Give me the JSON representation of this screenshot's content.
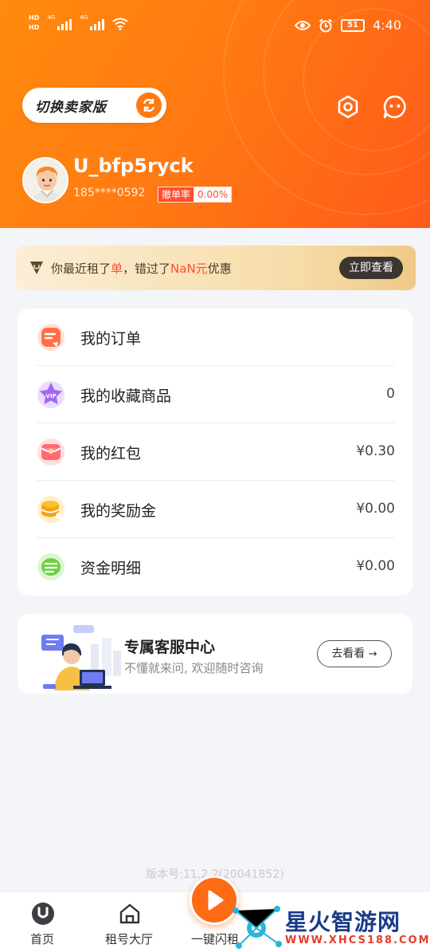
{
  "status_bar": {
    "hd_label": "HD",
    "network_1": "4G",
    "network_2": "4G",
    "battery": "51",
    "time": "4:40"
  },
  "header": {
    "switch_label": "切换卖家版",
    "username": "U_bfp5ryck",
    "phone": "185****0592",
    "rate_label": "撤单率",
    "rate_value": "0.00%"
  },
  "promo": {
    "part1": "你最近租了",
    "highlight1": "单",
    "part2": "，错过了",
    "highlight2": "NaN元",
    "part3": "优惠",
    "button": "立即查看"
  },
  "menu": {
    "items": [
      {
        "label": "我的订单",
        "value": "",
        "icon": "order-icon"
      },
      {
        "label": "我的收藏商品",
        "value": "0",
        "icon": "vip-star-icon"
      },
      {
        "label": "我的红包",
        "value": "¥0.30",
        "icon": "red-packet-icon"
      },
      {
        "label": "我的奖励金",
        "value": "¥0.00",
        "icon": "coin-stack-icon"
      },
      {
        "label": "资金明细",
        "value": "¥0.00",
        "icon": "fund-detail-icon"
      }
    ]
  },
  "service": {
    "title": "专属客服中心",
    "subtitle": "不懂就来问, 欢迎随时咨询",
    "button": "去看看"
  },
  "version": "版本号:11.2.2(20041852)",
  "tabbar": {
    "home": "首页",
    "hall": "租号大厅",
    "flash": "一键闪租"
  },
  "watermark": {
    "text": "星火智游网",
    "url": "WWW.XHCS188.COM"
  },
  "colors": {
    "brand_orange": "#ff7a12",
    "accent_red": "#ff4d2e"
  }
}
